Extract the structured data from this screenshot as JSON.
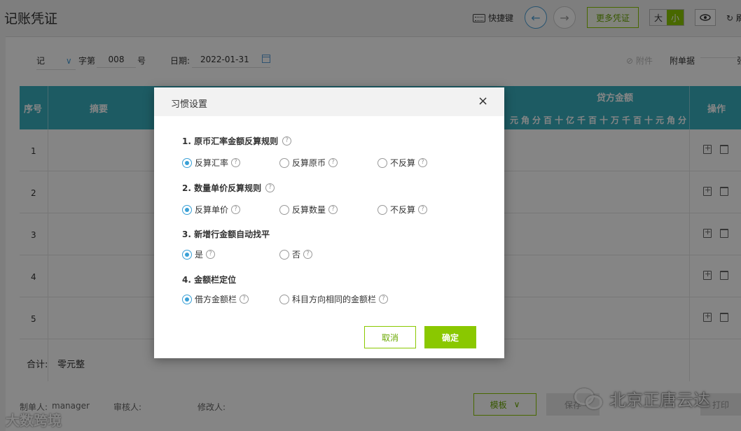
{
  "header": {
    "title": "记账凭证",
    "shortcut_label": "快捷键",
    "prev_glyph": "←",
    "next_glyph": "→",
    "more_label": "更多凭证",
    "size_large": "大",
    "size_small": "小",
    "refresh_label": "↻ 刷"
  },
  "form": {
    "voucher_word": "记",
    "word_suffix": "字第",
    "voucher_no": "008",
    "no_suffix": "号",
    "date_label": "日期:",
    "date_value": "2022-01-31",
    "attach_label": "⊘ 附件",
    "attached_docs_label": "附单据",
    "attached_docs_unit": "张"
  },
  "table": {
    "col_seq": "序号",
    "col_summary": "摘要",
    "col_credit": "贷方金额",
    "col_ops": "操作",
    "debit_digits_tail": "元角分",
    "credit_digits": "百十亿千百十万千百十元角分",
    "rows": [
      "1",
      "2",
      "3",
      "4",
      "5"
    ],
    "total_label": "合计:",
    "total_value": "零元整"
  },
  "footer": {
    "maker_label": "制单人:",
    "maker_value": "manager",
    "reviewer_label": "审核人:",
    "modifier_label": "修改人:",
    "template_label": "模板",
    "save_label": "保存",
    "print_label": "打印"
  },
  "watermarks": {
    "left": "大数跨境",
    "right": "北京正唐云达"
  },
  "modal": {
    "title": "习惯设置",
    "close_glyph": "×",
    "help_glyph": "?",
    "sections": [
      {
        "title": "1. 原币汇率金额反算规则",
        "options": [
          "反算汇率",
          "反算原币",
          "不反算"
        ],
        "selected": 0
      },
      {
        "title": "2. 数量单价反算规则",
        "options": [
          "反算单价",
          "反算数量",
          "不反算"
        ],
        "selected": 0
      },
      {
        "title": "3. 新增行金额自动找平",
        "options": [
          "是",
          "否"
        ],
        "selected": 0
      },
      {
        "title": "4. 金额栏定位",
        "options": [
          "借方金额栏",
          "科目方向相同的金额栏"
        ],
        "selected": 0
      }
    ],
    "cancel_label": "取消",
    "ok_label": "确定"
  },
  "colors": {
    "accent_green": "#8ac800",
    "header_teal": "#39aebf",
    "radio_blue": "#39a0d6"
  }
}
